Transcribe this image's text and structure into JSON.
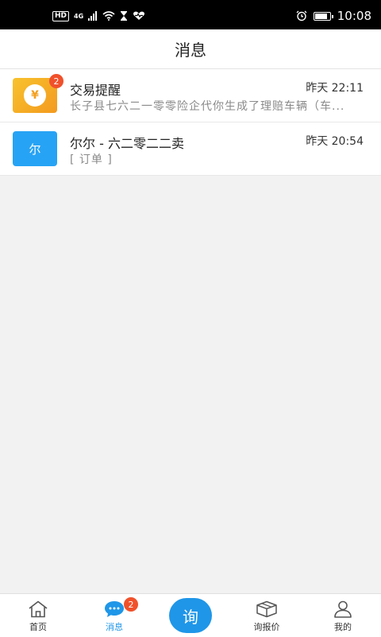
{
  "status_bar": {
    "hd": "HD",
    "network": "4G",
    "time": "10:08",
    "battery_level": 0.75
  },
  "header": {
    "title": "消息"
  },
  "messages": [
    {
      "name": "交易提醒",
      "time": "昨天 22:11",
      "preview": "长子县七六二一零零险企代你生成了理赔车辆（车...",
      "badge": "2",
      "avatar_icon": "yen-icon",
      "avatar_color": "#f6b128"
    },
    {
      "name": "尔尔 - 六二零二二卖",
      "time": "昨天 20:54",
      "preview": "[ 订单 ]",
      "avatar_text": "尔",
      "avatar_color": "#27a3f5"
    }
  ],
  "tabbar": {
    "home": "首页",
    "messages": "消息",
    "messages_badge": "2",
    "ask": "询",
    "quote": "询报价",
    "mine": "我的",
    "active_color": "#1f96e8"
  }
}
